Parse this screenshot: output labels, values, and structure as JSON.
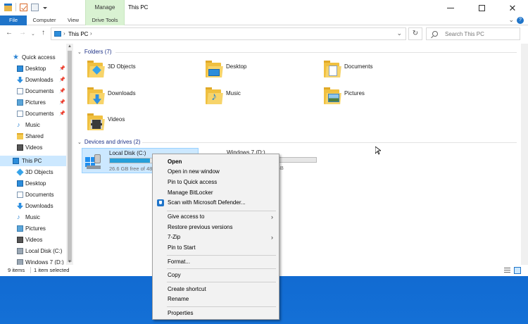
{
  "window": {
    "title": "This PC",
    "manage_label": "Manage"
  },
  "ribbon": {
    "tabs": [
      "File",
      "Computer",
      "View",
      "Drive Tools"
    ]
  },
  "address": {
    "path": "This PC",
    "search_placeholder": "Search This PC"
  },
  "navpane": {
    "quick_access": "Quick access",
    "quick_items": [
      {
        "label": "Desktop",
        "icon": "desktop-icon",
        "pinned": true
      },
      {
        "label": "Downloads",
        "icon": "downloads-icon",
        "pinned": true
      },
      {
        "label": "Documents",
        "icon": "documents-icon",
        "pinned": true
      },
      {
        "label": "Pictures",
        "icon": "pictures-icon",
        "pinned": true
      },
      {
        "label": "Documents",
        "icon": "documents-icon",
        "pinned": true
      },
      {
        "label": "Music",
        "icon": "music-icon",
        "pinned": false
      },
      {
        "label": "Shared",
        "icon": "folder-icon",
        "pinned": false
      },
      {
        "label": "Videos",
        "icon": "videos-icon",
        "pinned": false
      }
    ],
    "this_pc": "This PC",
    "pc_items": [
      {
        "label": "3D Objects",
        "icon": "3d-objects-icon"
      },
      {
        "label": "Desktop",
        "icon": "desktop-icon"
      },
      {
        "label": "Documents",
        "icon": "documents-icon"
      },
      {
        "label": "Downloads",
        "icon": "downloads-icon"
      },
      {
        "label": "Music",
        "icon": "music-icon"
      },
      {
        "label": "Pictures",
        "icon": "pictures-icon"
      },
      {
        "label": "Videos",
        "icon": "videos-icon"
      },
      {
        "label": "Local Disk (C:)",
        "icon": "drive-icon"
      },
      {
        "label": "Windows 7 (D:)",
        "icon": "drive-icon"
      }
    ]
  },
  "content": {
    "folders_header": "Folders (7)",
    "folders": [
      "3D Objects",
      "Desktop",
      "Documents",
      "Downloads",
      "Music",
      "Pictures",
      "Videos"
    ],
    "devices_header": "Devices and drives (2)",
    "drives": [
      {
        "name": "Local Disk (C:)",
        "free_text": "26.6 GB free of 48",
        "used_fraction": 0.45
      },
      {
        "name": "Windows 7 (D:)",
        "free_text": "GB",
        "used_fraction": 0.05
      }
    ]
  },
  "status": {
    "items": "9 items",
    "selected": "1 item selected"
  },
  "context_menu": {
    "items": [
      {
        "label": "Open",
        "bold": true
      },
      {
        "label": "Open in new window"
      },
      {
        "label": "Pin to Quick access"
      },
      {
        "label": "Manage BitLocker"
      },
      {
        "label": "Scan with Microsoft Defender...",
        "icon": "defender-shield-icon"
      },
      {
        "label": "Give access to",
        "submenu": true
      },
      {
        "label": "Restore previous versions"
      },
      {
        "label": "7-Zip",
        "submenu": true
      },
      {
        "label": "Pin to Start"
      },
      {
        "label": "Format..."
      },
      {
        "label": "Copy"
      },
      {
        "label": "Create shortcut"
      },
      {
        "label": "Rename"
      },
      {
        "label": "Properties"
      }
    ]
  },
  "colors": {
    "accent": "#1f74c9",
    "selection": "#cce8ff",
    "manage_tab": "#d9f2d2",
    "drive_bar": "#26a0da",
    "desktop": "#0b5cc6"
  }
}
